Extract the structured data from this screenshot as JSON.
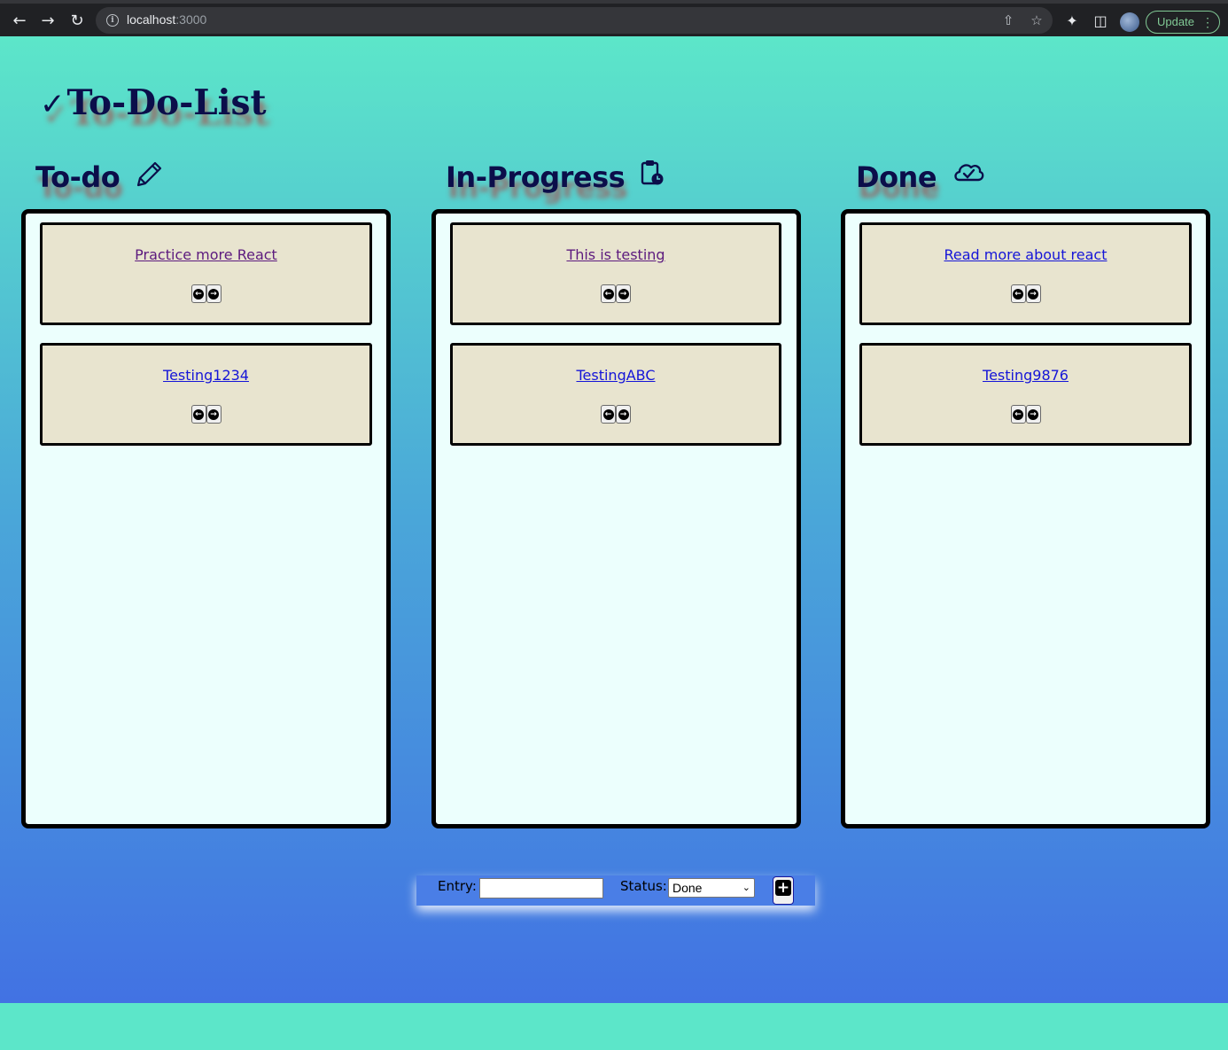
{
  "browser": {
    "url_host": "localhost",
    "url_port": ":3000",
    "update_label": "Update"
  },
  "app": {
    "title": "To-Do-List"
  },
  "columns": [
    {
      "heading": "To-do",
      "icon": "pencil-icon",
      "cards": [
        {
          "text": "Practice more React",
          "visited": true
        },
        {
          "text": "Testing1234",
          "visited": false
        }
      ]
    },
    {
      "heading": "In-Progress",
      "icon": "clipboard-clock-icon",
      "cards": [
        {
          "text": "This is testing",
          "visited": true
        },
        {
          "text": "TestingABC",
          "visited": false
        }
      ]
    },
    {
      "heading": "Done",
      "icon": "cloud-check-icon",
      "cards": [
        {
          "text": "Read more about react",
          "visited": false
        },
        {
          "text": "Testing9876",
          "visited": false
        }
      ]
    }
  ],
  "form": {
    "entry_label": "Entry:",
    "entry_value": "",
    "status_label": "Status:",
    "status_value": "Done"
  },
  "colors": {
    "heading": "#0b0e4a",
    "column_bg": "#ecfffd",
    "card_bg": "#e8e4cf",
    "link": "#1515d8",
    "link_visited": "#5c1a7e"
  }
}
